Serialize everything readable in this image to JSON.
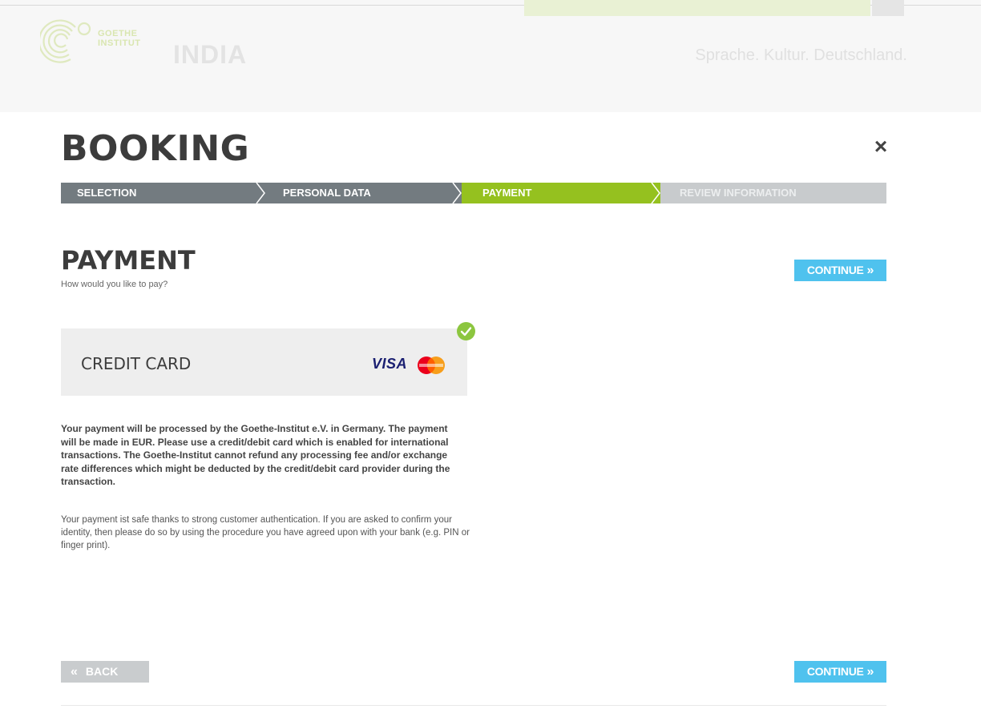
{
  "site": {
    "logo_text_line1": "GOETHE",
    "logo_text_line2": "INSTITUT",
    "country": "INDIA",
    "slogan": "Sprache. Kultur. Deutschland."
  },
  "booking": {
    "title": "BOOKING",
    "close_label": "×"
  },
  "steps": [
    {
      "label": "SELECTION",
      "state": "completed"
    },
    {
      "label": "PERSONAL DATA",
      "state": "completed"
    },
    {
      "label": "PAYMENT",
      "state": "active"
    },
    {
      "label": "REVIEW INFORMATION",
      "state": "upcoming"
    }
  ],
  "payment": {
    "title": "PAYMENT",
    "subtitle": "How would you like to pay?",
    "continue_label": "CONTINUE",
    "back_label": "BACK",
    "option": {
      "label": "CREDIT CARD",
      "selected": true,
      "visa_text": "VISA"
    },
    "info_bold": "Your payment will be processed by the Goethe-Institut e.V. in Germany. The payment will be made in EUR. Please use a credit/debit card which is enabled for international transactions. The Goethe-Institut cannot refund any processing fee and/or exchange rate differences which might be deducted by the credit/debit card provider during the transaction.",
    "info_normal": "Your payment ist safe thanks to strong customer authentication. If you are asked to confirm your identity, then please do so by using the procedure you have agreed upon with your bank (e.g. PIN or finger print)."
  },
  "colors": {
    "accent_green": "#95c11f",
    "step_grey": "#737b80",
    "step_upcoming": "#c8cbcd",
    "button_blue": "#4fc2ee",
    "button_grey": "#c9ccce",
    "visa_blue": "#1a1f71"
  },
  "icons": {
    "close": "close-icon",
    "check": "check-circle-icon",
    "chevron_right": "double-chevron-right-icon",
    "chevron_left": "double-chevron-left-icon"
  }
}
